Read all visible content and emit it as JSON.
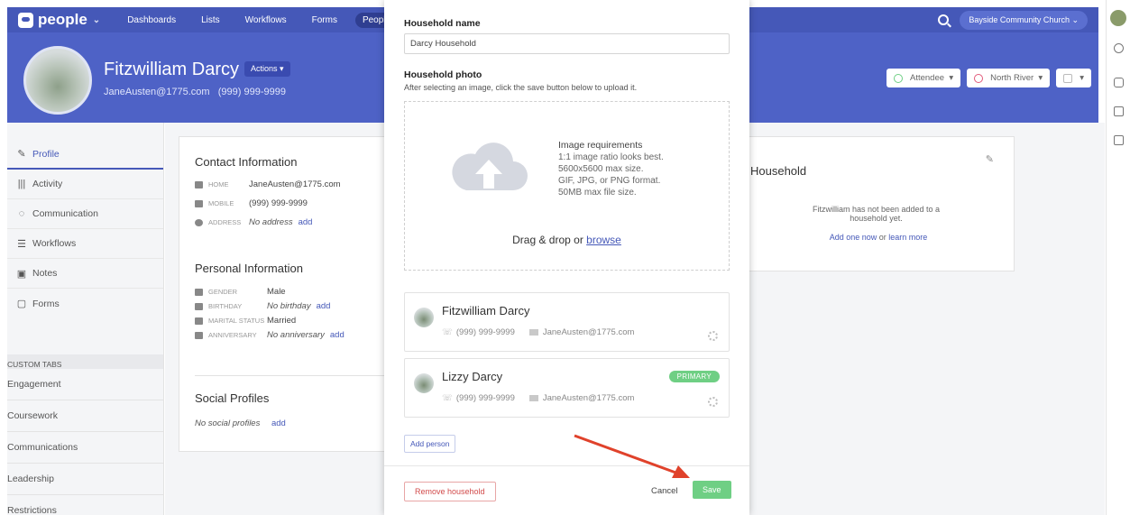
{
  "nav": {
    "logo": "people",
    "links": [
      "Dashboards",
      "Lists",
      "Workflows",
      "Forms",
      "People"
    ],
    "active_link": "People",
    "org": "Bayside Community Church"
  },
  "profile": {
    "name": "Fitzwilliam Darcy",
    "actions_label": "Actions",
    "contact_line": "JaneAusten@1775.com   (999) 999-9999",
    "buttons": [
      "Attendee",
      "North River",
      ""
    ]
  },
  "sidebar": {
    "items": [
      {
        "label": "Profile",
        "icon": "pencil-icon"
      },
      {
        "label": "Activity",
        "icon": "bars-icon"
      },
      {
        "label": "Communication",
        "icon": "speech-bubble-icon"
      },
      {
        "label": "Workflows",
        "icon": "list-icon"
      },
      {
        "label": "Notes",
        "icon": "note-icon"
      },
      {
        "label": "Forms",
        "icon": "form-icon"
      }
    ],
    "custom_tabs_heading": "CUSTOM TABS",
    "custom_tabs": [
      "Engagement",
      "Coursework",
      "Communications",
      "Leadership",
      "Restrictions"
    ]
  },
  "contact_info": {
    "title": "Contact Information",
    "home_label": "HOME",
    "home_value": "JaneAusten@1775.com",
    "mobile_label": "MOBILE",
    "mobile_value": "(999) 999-9999",
    "address_label": "ADDRESS",
    "address_value": "No address",
    "address_add": "add"
  },
  "personal_info": {
    "title": "Personal Information",
    "gender_label": "GENDER",
    "gender_value": "Male",
    "birthday_label": "BIRTHDAY",
    "birthday_value": "No birthday",
    "birthday_add": "add",
    "marital_label": "MARITAL STATUS",
    "marital_value": "Married",
    "anniversary_label": "ANNIVERSARY",
    "anniversary_value": "No anniversary",
    "anniversary_add": "add"
  },
  "social": {
    "title": "Social Profiles",
    "empty": "No social profiles",
    "add": "add"
  },
  "household_card": {
    "title": "Household",
    "message": "Fitzwilliam has not been added to a household yet.",
    "add_link": "Add one now",
    "or": "or",
    "learn_link": "learn more"
  },
  "modal": {
    "name_label": "Household name",
    "name_value": "Darcy Household",
    "photo_label": "Household photo",
    "photo_hint": "After selecting an image, click the save button below to upload it.",
    "req_title": "Image requirements",
    "req_lines": [
      "1:1 image ratio looks best.",
      "5600x5600 max size.",
      "GIF, JPG, or PNG format.",
      "50MB max file size."
    ],
    "drag_text": "Drag & drop or",
    "browse": "browse",
    "people": [
      {
        "name": "Fitzwilliam Darcy",
        "phone": "(999) 999-9999",
        "email": "JaneAusten@1775.com",
        "primary": false
      },
      {
        "name": "Lizzy Darcy",
        "phone": "(999) 999-9999",
        "email": "JaneAusten@1775.com",
        "primary": true
      }
    ],
    "primary_badge": "PRIMARY",
    "add_person": "Add person",
    "remove": "Remove household",
    "cancel": "Cancel",
    "save": "Save"
  },
  "colors": {
    "brand": "#4558b8",
    "header": "#4e62c6",
    "success": "#6fcf84",
    "danger": "#d24b4b",
    "annotation_arrow": "#e0422b"
  }
}
